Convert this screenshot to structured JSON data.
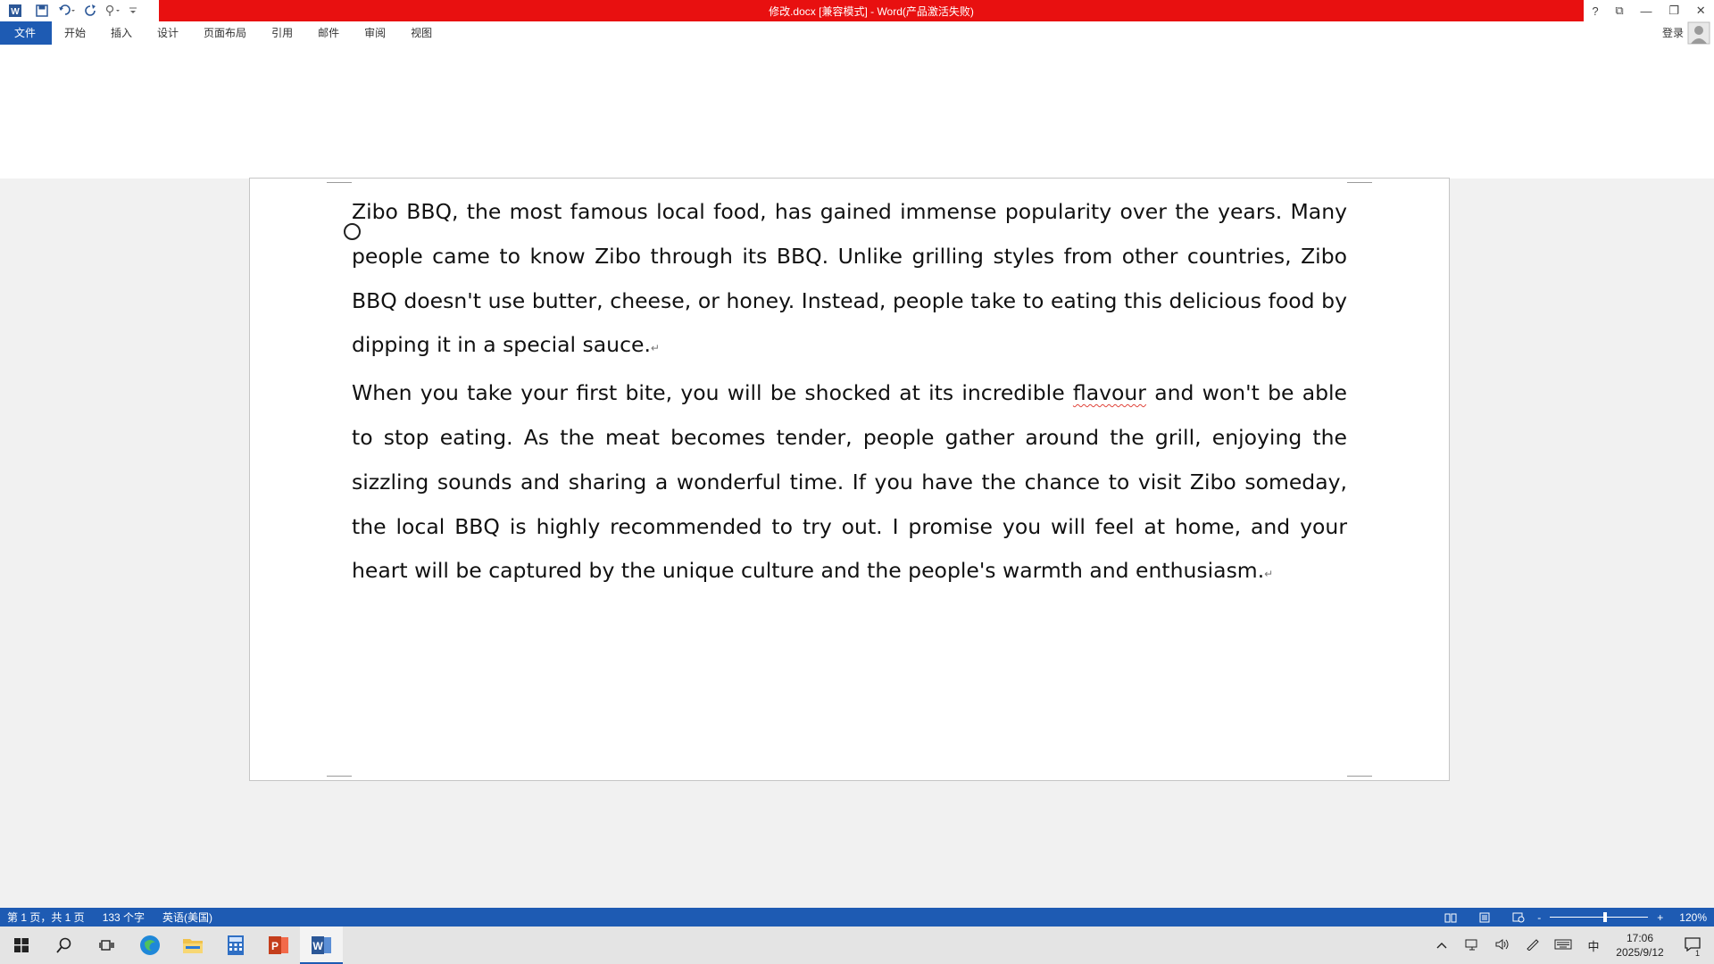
{
  "window": {
    "title": "修改.docx [兼容模式] - Word(产品激活失败)",
    "controls": [
      "?",
      "⧉",
      "—",
      "❐",
      "✕"
    ]
  },
  "ribbon": {
    "file_tab": "文件",
    "tabs": [
      "开始",
      "插入",
      "设计",
      "页面布局",
      "引用",
      "邮件",
      "审阅",
      "视图"
    ],
    "login": "登录"
  },
  "document": {
    "paragraphs": [
      "Zibo BBQ, the most famous local food, has gained immense popularity over the years. Many people came to know Zibo through its BBQ. Unlike grilling styles from other countries, Zibo BBQ doesn't use butter, cheese, or honey. Instead, people take to eating this delicious food by dipping it in a special sauce.",
      {
        "before": "When you take your first bite, you will be shocked at its incredible ",
        "misspelled": "flavour",
        "after": " and won't be able to stop eating. As the meat becomes tender, people gather around the grill, enjoying the sizzling sounds and sharing a wonderful time. If you have the chance to visit Zibo someday, the local BBQ is highly recommended to try out. I promise you will feel at home, and your heart will be captured by the unique culture and the people's warmth and enthusiasm."
      }
    ],
    "paragraph_mark": "↵"
  },
  "status_bar": {
    "page": "第 1 页，共 1 页",
    "word_count": "133 个字",
    "language": "英语(美国)",
    "zoom_minus": "-",
    "zoom_plus": "+",
    "zoom": "120%"
  },
  "taskbar": {
    "apps": [
      "start-icon",
      "search-icon",
      "task-view-icon",
      "browser-icon",
      "file-explorer-icon",
      "calculator-icon",
      "powerpoint-icon",
      "word-icon"
    ],
    "tray_ime": "中",
    "time": "17:06",
    "date": "2025/9/12",
    "notification_count": "1"
  }
}
